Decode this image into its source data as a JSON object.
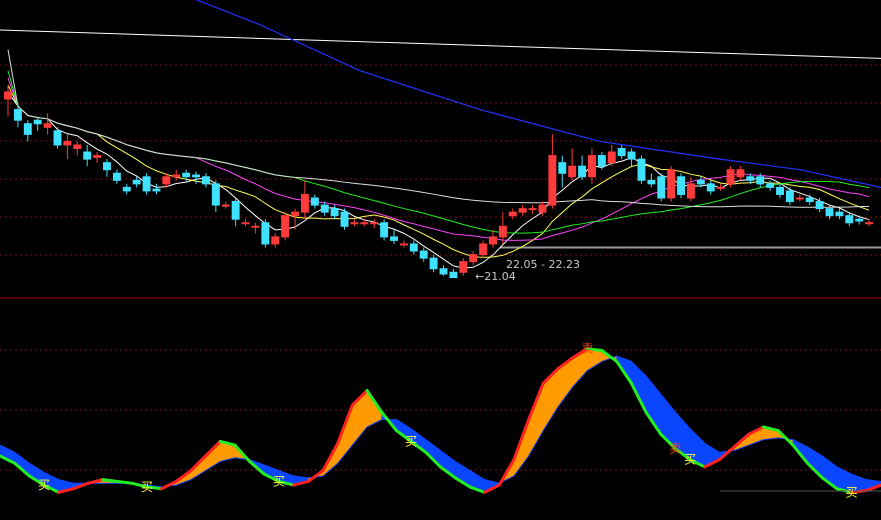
{
  "colors": {
    "background": "#000000",
    "grid": "#7a1414",
    "separator": "#aa0000",
    "up": "#ff3b3b",
    "down": "#40e0ff",
    "ma5": "#ffffff",
    "ma10": "#ffff55",
    "ma20": "#ff44ff",
    "ma30": "#22ee22",
    "ma60": "#dddddd",
    "ma120": "#2233ff",
    "ma250": "#ffffff",
    "fast_up": "#ff2020",
    "fast_down": "#22ee22",
    "fill_bull": "#ff9a00",
    "fill_bear": "#0a46ff",
    "support_line": "#9a9a9a",
    "signal_buy": "#ffff40",
    "signal_sell": "#ff4010"
  },
  "annotations": {
    "range_label": "22.05 - 22.23",
    "low_label": "←21.04"
  },
  "chart_data": [
    {
      "type": "candlestick",
      "title": "",
      "price_range": [
        20.5,
        28.9
      ],
      "candles": [
        [
          26.1,
          26.3,
          25.6,
          26.5
        ],
        [
          25.8,
          25.5,
          25.3,
          26.0
        ],
        [
          25.4,
          25.1,
          24.9,
          25.5
        ],
        [
          25.5,
          25.4,
          25.2,
          25.6
        ],
        [
          25.3,
          25.4,
          25.1,
          25.7
        ],
        [
          25.2,
          24.8,
          24.7,
          25.3
        ],
        [
          24.8,
          24.9,
          24.4,
          25.1
        ],
        [
          24.7,
          24.8,
          24.5,
          24.9
        ],
        [
          24.6,
          24.4,
          24.2,
          24.8
        ],
        [
          24.45,
          24.5,
          24.3,
          24.6
        ],
        [
          24.3,
          24.1,
          23.9,
          24.4
        ],
        [
          24.0,
          23.8,
          23.7,
          24.1
        ],
        [
          23.6,
          23.5,
          23.4,
          23.7
        ],
        [
          23.8,
          23.7,
          23.6,
          23.9
        ],
        [
          23.9,
          23.5,
          23.4,
          24.0
        ],
        [
          23.55,
          23.5,
          23.4,
          23.7
        ],
        [
          23.7,
          23.9,
          23.6,
          24.0
        ],
        [
          23.9,
          23.95,
          23.8,
          24.1
        ],
        [
          24.0,
          23.9,
          23.75,
          24.1
        ],
        [
          23.95,
          23.9,
          23.7,
          24.05
        ],
        [
          23.9,
          23.7,
          23.6,
          24.0
        ],
        [
          23.7,
          23.1,
          22.9,
          23.8
        ],
        [
          23.1,
          23.1,
          23.0,
          23.2
        ],
        [
          23.2,
          22.7,
          22.5,
          23.3
        ],
        [
          22.6,
          22.6,
          22.5,
          22.7
        ],
        [
          22.5,
          22.5,
          22.3,
          22.6
        ],
        [
          22.6,
          22.0,
          21.9,
          22.7
        ],
        [
          22.0,
          22.2,
          21.9,
          22.3
        ],
        [
          22.2,
          22.8,
          22.1,
          22.9
        ],
        [
          22.8,
          22.9,
          22.4,
          23.0
        ],
        [
          22.9,
          23.4,
          22.7,
          23.8
        ],
        [
          23.3,
          23.1,
          23.0,
          23.4
        ],
        [
          23.1,
          22.9,
          22.8,
          23.2
        ],
        [
          23.0,
          22.8,
          22.7,
          23.1
        ],
        [
          22.9,
          22.5,
          22.4,
          23.0
        ],
        [
          22.6,
          22.6,
          22.5,
          22.7
        ],
        [
          22.6,
          22.6,
          22.5,
          22.7
        ],
        [
          22.6,
          22.6,
          22.45,
          22.7
        ],
        [
          22.6,
          22.2,
          22.1,
          22.7
        ],
        [
          22.2,
          22.1,
          22.0,
          22.4
        ],
        [
          22.0,
          22.0,
          21.9,
          22.1
        ],
        [
          22.0,
          21.8,
          21.7,
          22.1
        ],
        [
          21.8,
          21.6,
          21.5,
          21.9
        ],
        [
          21.6,
          21.3,
          21.2,
          21.7
        ],
        [
          21.3,
          21.15,
          21.1,
          21.4
        ],
        [
          21.2,
          21.05,
          21.04,
          21.3
        ],
        [
          21.2,
          21.5,
          21.1,
          21.6
        ],
        [
          21.5,
          21.7,
          21.4,
          21.8
        ],
        [
          21.7,
          22.0,
          21.6,
          22.1
        ],
        [
          22.0,
          22.2,
          21.9,
          22.4
        ],
        [
          22.2,
          22.5,
          22.0,
          22.9
        ],
        [
          22.8,
          22.9,
          22.7,
          23.0
        ],
        [
          22.9,
          23.0,
          22.8,
          23.1
        ],
        [
          23.0,
          23.0,
          22.85,
          23.1
        ],
        [
          22.9,
          23.1,
          22.8,
          23.2
        ],
        [
          23.1,
          24.5,
          23.0,
          25.1
        ],
        [
          24.3,
          24.0,
          23.6,
          24.5
        ],
        [
          23.9,
          24.2,
          23.8,
          24.7
        ],
        [
          24.2,
          23.9,
          23.8,
          24.5
        ],
        [
          23.9,
          24.5,
          23.7,
          24.7
        ],
        [
          24.5,
          24.2,
          24.1,
          24.6
        ],
        [
          24.3,
          24.6,
          24.2,
          24.8
        ],
        [
          24.7,
          24.5,
          24.4,
          24.8
        ],
        [
          24.6,
          24.4,
          24.2,
          24.7
        ],
        [
          24.4,
          23.8,
          23.7,
          24.5
        ],
        [
          23.8,
          23.7,
          23.6,
          24.0
        ],
        [
          23.9,
          23.3,
          23.2,
          24.0
        ],
        [
          23.3,
          24.1,
          23.2,
          24.2
        ],
        [
          23.9,
          23.4,
          23.3,
          24.0
        ],
        [
          23.3,
          23.7,
          23.2,
          23.9
        ],
        [
          23.8,
          23.7,
          23.6,
          23.9
        ],
        [
          23.7,
          23.5,
          23.4,
          23.8
        ],
        [
          23.6,
          23.6,
          23.5,
          23.7
        ],
        [
          23.7,
          24.1,
          23.6,
          24.2
        ],
        [
          23.9,
          24.1,
          23.8,
          24.2
        ],
        [
          23.9,
          23.8,
          23.7,
          24.0
        ],
        [
          23.9,
          23.7,
          23.6,
          24.0
        ],
        [
          23.7,
          23.6,
          23.5,
          23.8
        ],
        [
          23.6,
          23.4,
          23.3,
          23.7
        ],
        [
          23.5,
          23.2,
          23.1,
          23.6
        ],
        [
          23.3,
          23.3,
          23.2,
          23.4
        ],
        [
          23.3,
          23.2,
          23.1,
          23.4
        ],
        [
          23.2,
          23.0,
          22.9,
          23.3
        ],
        [
          23.0,
          22.8,
          22.7,
          23.1
        ],
        [
          22.9,
          22.8,
          22.7,
          23.0
        ],
        [
          22.8,
          22.6,
          22.5,
          22.9
        ],
        [
          22.7,
          22.65,
          22.55,
          22.8
        ],
        [
          22.6,
          22.6,
          22.5,
          22.7
        ]
      ]
    },
    {
      "type": "area",
      "title": "",
      "ylim": [
        -5,
        105
      ],
      "series": [
        {
          "name": "",
          "values": [
            28,
            24,
            17,
            12,
            8,
            10,
            13,
            15,
            14,
            13,
            11,
            10,
            14,
            20,
            28,
            36,
            34,
            25,
            18,
            14,
            12,
            14,
            20,
            35,
            56,
            64,
            52,
            42,
            36,
            30,
            22,
            16,
            11,
            8,
            12,
            26,
            48,
            68,
            76,
            82,
            87,
            86,
            80,
            68,
            52,
            40,
            32,
            26,
            22,
            26,
            33,
            40,
            44,
            42,
            34,
            24,
            16,
            10,
            8,
            9,
            12
          ]
        },
        {
          "name": "",
          "values": [
            34,
            30,
            24,
            19,
            15,
            13,
            13,
            13,
            13,
            13,
            12,
            11,
            12,
            15,
            20,
            25,
            27,
            26,
            23,
            20,
            17,
            16,
            17,
            24,
            34,
            44,
            48,
            48,
            43,
            37,
            31,
            25,
            20,
            15,
            13,
            17,
            28,
            42,
            55,
            66,
            75,
            80,
            83,
            80,
            72,
            62,
            52,
            43,
            35,
            30,
            31,
            34,
            37,
            38,
            37,
            33,
            28,
            22,
            18,
            15,
            14
          ]
        }
      ],
      "signals": [
        {
          "index": 3,
          "text": "买"
        },
        {
          "index": 10,
          "text": "买"
        },
        {
          "index": 19,
          "text": "买"
        },
        {
          "index": 28,
          "text": "买"
        },
        {
          "index": 40,
          "text": "卖"
        },
        {
          "index": 46,
          "text": "卖"
        },
        {
          "index": 47,
          "text": "买"
        },
        {
          "index": 58,
          "text": "买"
        }
      ]
    }
  ]
}
